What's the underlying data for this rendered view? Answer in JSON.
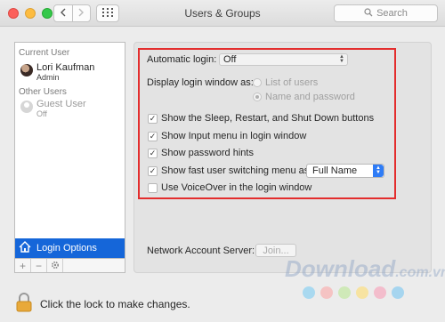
{
  "window": {
    "title": "Users & Groups"
  },
  "search": {
    "placeholder": "Search"
  },
  "sidebar": {
    "current_user_section": "Current User",
    "current_user": {
      "name": "Lori Kaufman",
      "role": "Admin"
    },
    "other_users_section": "Other Users",
    "guest_user": {
      "name": "Guest User",
      "status": "Off"
    },
    "login_options_label": "Login Options",
    "footer_buttons": [
      "+",
      "−",
      "gear"
    ]
  },
  "login": {
    "automatic_login_label": "Automatic login:",
    "automatic_login_value": "Off",
    "display_as_label": "Display login window as:",
    "display_options": [
      {
        "label": "List of users",
        "selected": false
      },
      {
        "label": "Name and password",
        "selected": true
      }
    ],
    "checkboxes": [
      {
        "label": "Show the Sleep, Restart, and Shut Down buttons",
        "checked": true
      },
      {
        "label": "Show Input menu in login window",
        "checked": true
      },
      {
        "label": "Show password hints",
        "checked": true
      },
      {
        "label": "Show fast user switching menu as",
        "checked": true
      },
      {
        "label": "Use VoiceOver in the login window",
        "checked": false
      }
    ],
    "fast_switch_value": "Full Name",
    "network_server_label": "Network Account Server:",
    "join_label": "Join..."
  },
  "footer": {
    "lock_text": "Click the lock to make changes."
  },
  "watermark": {
    "text": "Download",
    "suffix": ".com.vn"
  },
  "colors": {
    "accent": "#1566d9",
    "highlight_border": "#e32d2d",
    "watermark_dots": [
      "#a9d9f0",
      "#f5c3c3",
      "#cfe9b8",
      "#f7e3a1",
      "#f3bdcc",
      "#a6d5ef"
    ]
  }
}
